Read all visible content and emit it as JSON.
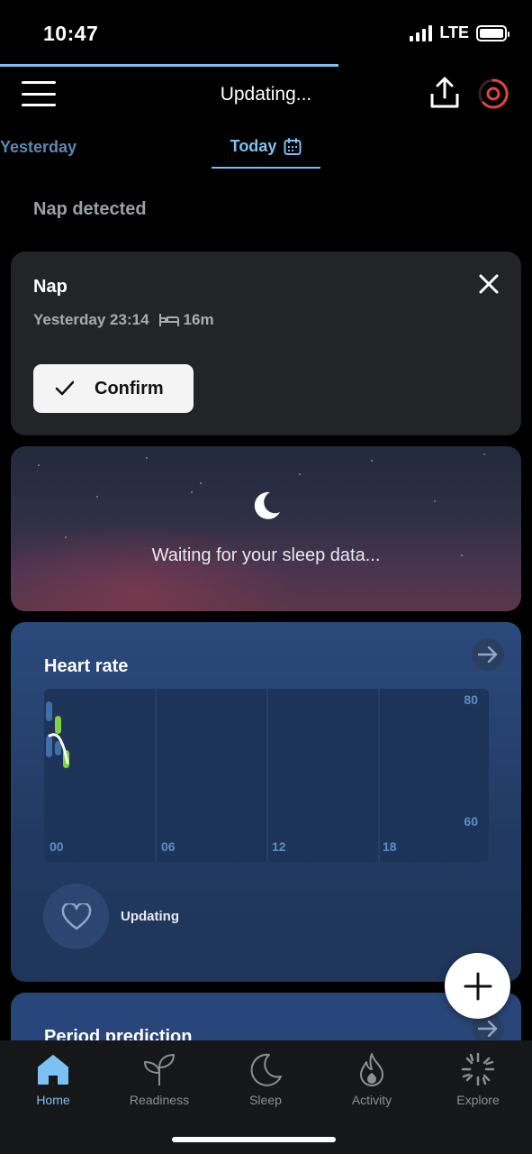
{
  "status_bar": {
    "time": "10:47",
    "network": "LTE"
  },
  "header": {
    "title": "Updating..."
  },
  "tabs": {
    "previous": "Yesterday",
    "current": "Today"
  },
  "section_label": "Nap detected",
  "nap_card": {
    "title": "Nap",
    "time": "Yesterday 23:14",
    "duration": "16m",
    "confirm_label": "Confirm"
  },
  "sleep_card": {
    "message": "Waiting for your sleep data..."
  },
  "heart_card": {
    "title": "Heart rate",
    "status": "Updating",
    "y_labels": [
      "80",
      "60"
    ],
    "x_labels": [
      "00",
      "06",
      "12",
      "18"
    ]
  },
  "period_card": {
    "title": "Period prediction"
  },
  "bottom_nav": [
    {
      "label": "Home",
      "active": true
    },
    {
      "label": "Readiness",
      "active": false
    },
    {
      "label": "Sleep",
      "active": false
    },
    {
      "label": "Activity",
      "active": false
    },
    {
      "label": "Explore",
      "active": false
    }
  ],
  "colors": {
    "accent": "#7cc1f2",
    "background": "#000000",
    "card": "#232428",
    "heart_card": "#2a4a7c",
    "hr_green": "#7ed43a",
    "hr_blue": "#3d6fa8",
    "ring_red": "#e0453c"
  }
}
